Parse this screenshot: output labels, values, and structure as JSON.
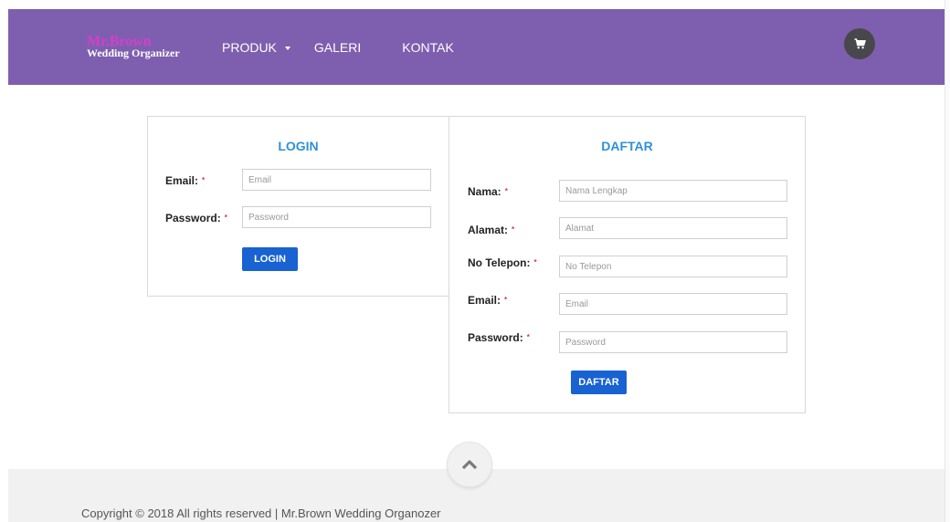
{
  "brand": {
    "name": "Mr.Brown",
    "tagline": "Wedding Organizer"
  },
  "nav": {
    "items": [
      {
        "label": "PRODUK",
        "has_dropdown": true
      },
      {
        "label": "GALERI"
      },
      {
        "label": "KONTAK"
      }
    ],
    "cart_icon": "shopping-cart-icon"
  },
  "login": {
    "title": "LOGIN",
    "required_mark": "*",
    "fields": [
      {
        "label": "Email:",
        "placeholder": "Email",
        "value": ""
      },
      {
        "label": "Password:",
        "placeholder": "Password",
        "value": ""
      }
    ],
    "button": "LOGIN"
  },
  "daftar": {
    "title": "DAFTAR",
    "required_mark": "*",
    "fields": [
      {
        "label": "Nama:",
        "placeholder": "Nama Lengkap",
        "value": ""
      },
      {
        "label": "Alamat:",
        "placeholder": "Alamat",
        "value": ""
      },
      {
        "label": "No Telepon:",
        "placeholder": "No Telepon",
        "value": ""
      },
      {
        "label": "Email:",
        "placeholder": "Email",
        "value": ""
      },
      {
        "label": "Password:",
        "placeholder": "Password",
        "value": ""
      }
    ],
    "button": "DAFTAR"
  },
  "footer": {
    "copyright": "Copyright © 2018 All rights reserved | Mr.Brown Wedding Organozer",
    "scroll_top_icon": "chevron-up-icon"
  },
  "colors": {
    "navbar": "#7e5faf",
    "brand_name": "#d63dcc",
    "panel_title": "#2f90d6",
    "button": "#1862d2",
    "required": "#d9363e",
    "cart_button": "#48484c",
    "footer": "#f1f1f1"
  }
}
